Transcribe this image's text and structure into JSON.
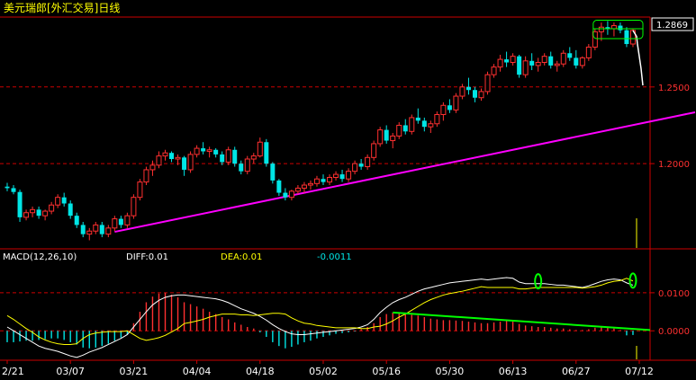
{
  "title": "美元瑞郎[外汇交易]日线",
  "last_price_badge": "1.2869",
  "macd_header": {
    "name": "MACD(12,26,10)",
    "diff": "DIFF:0.01",
    "dea": "DEA:0.01",
    "macd": "-0.0011"
  },
  "colors": {
    "background": "#000000",
    "frame": "#cc0000",
    "up_candle": "#ff3030",
    "down_candle": "#00e5e5",
    "trendline_price": "#ff00ff",
    "trendline_macd": "#00ff00",
    "diff_line": "#ffffff",
    "dea_line": "#ffff00",
    "label": "#ffff00",
    "axis_text": "#ff3030"
  },
  "chart_data": [
    {
      "type": "candlestick",
      "title": "美元瑞郎[外汇交易]日线",
      "y_ticks": [
        "1.2000",
        "1.2500"
      ],
      "y_tick_values": [
        1.2,
        1.25
      ],
      "ylim": [
        1.145,
        1.295
      ],
      "x_tick_labels": [
        "2/21",
        "03/07",
        "03/21",
        "04/04",
        "04/18",
        "05/02",
        "05/16",
        "05/30",
        "06/13",
        "06/27",
        "07/12"
      ],
      "x_tick_index": [
        0,
        10,
        20,
        30,
        40,
        50,
        60,
        70,
        80,
        90,
        100
      ],
      "last_price": 1.2869,
      "grid": true,
      "candles": [
        [
          1.185,
          1.1875,
          1.182,
          1.184
        ],
        [
          1.184,
          1.186,
          1.18,
          1.1815
        ],
        [
          1.1815,
          1.183,
          1.162,
          1.165
        ],
        [
          1.165,
          1.17,
          1.163,
          1.168
        ],
        [
          1.168,
          1.172,
          1.165,
          1.17
        ],
        [
          1.17,
          1.172,
          1.164,
          1.166
        ],
        [
          1.166,
          1.17,
          1.163,
          1.169
        ],
        [
          1.169,
          1.175,
          1.167,
          1.173
        ],
        [
          1.173,
          1.18,
          1.171,
          1.178
        ],
        [
          1.178,
          1.181,
          1.172,
          1.174
        ],
        [
          1.174,
          1.176,
          1.164,
          1.166
        ],
        [
          1.166,
          1.168,
          1.158,
          1.16
        ],
        [
          1.16,
          1.162,
          1.152,
          1.154
        ],
        [
          1.154,
          1.158,
          1.15,
          1.156
        ],
        [
          1.156,
          1.162,
          1.154,
          1.16
        ],
        [
          1.16,
          1.162,
          1.152,
          1.154
        ],
        [
          1.154,
          1.16,
          1.152,
          1.158
        ],
        [
          1.158,
          1.166,
          1.156,
          1.164
        ],
        [
          1.164,
          1.166,
          1.158,
          1.16
        ],
        [
          1.16,
          1.168,
          1.158,
          1.166
        ],
        [
          1.166,
          1.18,
          1.164,
          1.178
        ],
        [
          1.178,
          1.19,
          1.176,
          1.188
        ],
        [
          1.188,
          1.198,
          1.186,
          1.196
        ],
        [
          1.196,
          1.202,
          1.192,
          1.199
        ],
        [
          1.199,
          1.208,
          1.197,
          1.205
        ],
        [
          1.205,
          1.209,
          1.202,
          1.207
        ],
        [
          1.207,
          1.208,
          1.201,
          1.203
        ],
        [
          1.203,
          1.206,
          1.199,
          1.204
        ],
        [
          1.204,
          1.205,
          1.192,
          1.196
        ],
        [
          1.196,
          1.208,
          1.194,
          1.206
        ],
        [
          1.206,
          1.212,
          1.204,
          1.21
        ],
        [
          1.21,
          1.214,
          1.206,
          1.208
        ],
        [
          1.208,
          1.211,
          1.204,
          1.209
        ],
        [
          1.209,
          1.21,
          1.204,
          1.206
        ],
        [
          1.206,
          1.208,
          1.199,
          1.201
        ],
        [
          1.201,
          1.211,
          1.199,
          1.209
        ],
        [
          1.209,
          1.211,
          1.198,
          1.2
        ],
        [
          1.2,
          1.202,
          1.193,
          1.195
        ],
        [
          1.195,
          1.205,
          1.193,
          1.203
        ],
        [
          1.203,
          1.207,
          1.2,
          1.205
        ],
        [
          1.205,
          1.217,
          1.204,
          1.214
        ],
        [
          1.214,
          1.216,
          1.198,
          1.2
        ],
        [
          1.2,
          1.201,
          1.187,
          1.189
        ],
        [
          1.189,
          1.19,
          1.179,
          1.181
        ],
        [
          1.181,
          1.184,
          1.176,
          1.178
        ],
        [
          1.178,
          1.183,
          1.176,
          1.182
        ],
        [
          1.182,
          1.186,
          1.18,
          1.184
        ],
        [
          1.184,
          1.188,
          1.181,
          1.186
        ],
        [
          1.186,
          1.189,
          1.183,
          1.187
        ],
        [
          1.187,
          1.192,
          1.185,
          1.19
        ],
        [
          1.19,
          1.193,
          1.186,
          1.188
        ],
        [
          1.188,
          1.193,
          1.186,
          1.191
        ],
        [
          1.191,
          1.195,
          1.189,
          1.193
        ],
        [
          1.193,
          1.196,
          1.188,
          1.19
        ],
        [
          1.19,
          1.197,
          1.188,
          1.195
        ],
        [
          1.195,
          1.202,
          1.193,
          1.2
        ],
        [
          1.2,
          1.203,
          1.196,
          1.198
        ],
        [
          1.198,
          1.206,
          1.196,
          1.204
        ],
        [
          1.204,
          1.215,
          1.202,
          1.213
        ],
        [
          1.213,
          1.224,
          1.211,
          1.222
        ],
        [
          1.222,
          1.225,
          1.213,
          1.215
        ],
        [
          1.215,
          1.22,
          1.21,
          1.218
        ],
        [
          1.218,
          1.227,
          1.216,
          1.225
        ],
        [
          1.225,
          1.229,
          1.219,
          1.221
        ],
        [
          1.221,
          1.232,
          1.219,
          1.23
        ],
        [
          1.23,
          1.236,
          1.226,
          1.228
        ],
        [
          1.228,
          1.23,
          1.221,
          1.224
        ],
        [
          1.224,
          1.228,
          1.22,
          1.226
        ],
        [
          1.226,
          1.234,
          1.224,
          1.232
        ],
        [
          1.232,
          1.24,
          1.228,
          1.238
        ],
        [
          1.238,
          1.242,
          1.233,
          1.235
        ],
        [
          1.235,
          1.246,
          1.233,
          1.244
        ],
        [
          1.244,
          1.252,
          1.242,
          1.25
        ],
        [
          1.25,
          1.256,
          1.245,
          1.248
        ],
        [
          1.248,
          1.25,
          1.24,
          1.243
        ],
        [
          1.243,
          1.249,
          1.241,
          1.247
        ],
        [
          1.247,
          1.26,
          1.245,
          1.258
        ],
        [
          1.258,
          1.265,
          1.256,
          1.263
        ],
        [
          1.263,
          1.271,
          1.26,
          1.268
        ],
        [
          1.268,
          1.273,
          1.263,
          1.266
        ],
        [
          1.266,
          1.272,
          1.264,
          1.27
        ],
        [
          1.27,
          1.271,
          1.256,
          1.258
        ],
        [
          1.258,
          1.27,
          1.256,
          1.267
        ],
        [
          1.267,
          1.272,
          1.261,
          1.264
        ],
        [
          1.264,
          1.269,
          1.26,
          1.266
        ],
        [
          1.266,
          1.272,
          1.264,
          1.27
        ],
        [
          1.27,
          1.273,
          1.262,
          1.264
        ],
        [
          1.264,
          1.267,
          1.26,
          1.265
        ],
        [
          1.265,
          1.274,
          1.263,
          1.272
        ],
        [
          1.272,
          1.276,
          1.267,
          1.269
        ],
        [
          1.269,
          1.274,
          1.262,
          1.264
        ],
        [
          1.264,
          1.27,
          1.262,
          1.269
        ],
        [
          1.269,
          1.278,
          1.267,
          1.276
        ],
        [
          1.276,
          1.288,
          1.274,
          1.286
        ],
        [
          1.286,
          1.292,
          1.28,
          1.289
        ],
        [
          1.289,
          1.293,
          1.284,
          1.288
        ],
        [
          1.288,
          1.292,
          1.283,
          1.29
        ],
        [
          1.29,
          1.292,
          1.285,
          1.287
        ],
        [
          1.287,
          1.289,
          1.276,
          1.278
        ],
        [
          1.278,
          1.288,
          1.276,
          1.2869
        ]
      ]
    },
    {
      "type": "line",
      "title": "MACD(12,26,10)",
      "y_ticks": [
        "0.0100",
        "0.0000"
      ],
      "y_tick_values": [
        0.01,
        0.0
      ],
      "ylim": [
        -0.0075,
        0.018
      ],
      "macd_bars": [
        -0.003,
        -0.003,
        -0.0028,
        -0.0026,
        -0.0026,
        -0.0024,
        -0.0022,
        -0.002,
        -0.002,
        -0.0024,
        -0.003,
        -0.0036,
        -0.0044,
        -0.0046,
        -0.0044,
        -0.004,
        -0.0034,
        -0.0026,
        -0.0018,
        -0.001,
        0.002,
        0.005,
        0.0075,
        0.009,
        0.0098,
        0.01,
        0.0095,
        0.0088,
        0.0075,
        0.007,
        0.0064,
        0.0058,
        0.005,
        0.0044,
        0.0036,
        0.003,
        0.0022,
        0.0016,
        0.001,
        0.0006,
        -0.0004,
        -0.0016,
        -0.003,
        -0.004,
        -0.0046,
        -0.0042,
        -0.0036,
        -0.003,
        -0.0026,
        -0.002,
        -0.0016,
        -0.0012,
        -0.0008,
        -0.0006,
        -0.0004,
        -0.0002,
        0.0004,
        0.001,
        0.002,
        0.0036,
        0.0044,
        0.0048,
        0.0046,
        0.0044,
        0.0042,
        0.004,
        0.0036,
        0.0032,
        0.003,
        0.0028,
        0.0028,
        0.0027,
        0.0026,
        0.0024,
        0.0022,
        0.002,
        0.002,
        0.0022,
        0.0024,
        0.0026,
        0.0024,
        0.0018,
        0.0014,
        0.0012,
        0.001,
        0.001,
        0.0008,
        0.0006,
        0.0006,
        0.0004,
        0.0002,
        0.0002,
        0.0004,
        0.0008,
        0.001,
        0.0008,
        0.0006,
        0.0002,
        -0.0012,
        -0.0011
      ],
      "series": [
        {
          "name": "DIFF",
          "values": [
            0.001,
            0.0,
            -0.001,
            -0.002,
            -0.003,
            -0.004,
            -0.0046,
            -0.005,
            -0.0054,
            -0.006,
            -0.0066,
            -0.007,
            -0.0064,
            -0.0056,
            -0.005,
            -0.0044,
            -0.0036,
            -0.0028,
            -0.002,
            -0.001,
            0.001,
            0.003,
            0.005,
            0.0068,
            0.008,
            0.0088,
            0.0092,
            0.0094,
            0.0094,
            0.0092,
            0.009,
            0.0088,
            0.0086,
            0.0084,
            0.008,
            0.0074,
            0.0066,
            0.0058,
            0.0052,
            0.0046,
            0.0038,
            0.0028,
            0.0016,
            0.0006,
            -0.0002,
            -0.0008,
            -0.001,
            -0.001,
            -0.0008,
            -0.0006,
            -0.0004,
            -0.0002,
            0.0,
            0.0002,
            0.0004,
            0.0006,
            0.001,
            0.0016,
            0.003,
            0.0048,
            0.0062,
            0.0074,
            0.0082,
            0.0088,
            0.0096,
            0.0104,
            0.011,
            0.0114,
            0.0118,
            0.0122,
            0.0126,
            0.0128,
            0.013,
            0.0132,
            0.0134,
            0.0136,
            0.0134,
            0.0136,
            0.0138,
            0.014,
            0.0138,
            0.0128,
            0.0124,
            0.0124,
            0.0124,
            0.0124,
            0.0122,
            0.012,
            0.012,
            0.0118,
            0.0116,
            0.0114,
            0.0118,
            0.0124,
            0.013,
            0.0134,
            0.0136,
            0.0134,
            0.0126,
            0.012
          ]
        },
        {
          "name": "DEA",
          "values": [
            0.004,
            0.003,
            0.0018,
            0.0006,
            -0.0004,
            -0.0016,
            -0.0024,
            -0.003,
            -0.0034,
            -0.0036,
            -0.0036,
            -0.0034,
            -0.002,
            -0.001,
            -0.0006,
            -0.0004,
            -0.0002,
            -0.0002,
            -0.0002,
            0.0,
            -0.001,
            -0.002,
            -0.0025,
            -0.0022,
            -0.0018,
            -0.0012,
            -0.0003,
            0.0006,
            0.0019,
            0.0022,
            0.0026,
            0.003,
            0.0036,
            0.004,
            0.0044,
            0.0044,
            0.0044,
            0.0042,
            0.0042,
            0.004,
            0.0042,
            0.0044,
            0.0046,
            0.0046,
            0.0044,
            0.0034,
            0.0026,
            0.002,
            0.0018,
            0.0014,
            0.0012,
            0.001,
            0.0008,
            0.0008,
            0.0008,
            0.0008,
            0.0006,
            0.0006,
            0.001,
            0.0012,
            0.0018,
            0.0026,
            0.0036,
            0.0044,
            0.0054,
            0.0064,
            0.0074,
            0.0082,
            0.0088,
            0.0094,
            0.0098,
            0.0101,
            0.0104,
            0.0108,
            0.0112,
            0.0116,
            0.0114,
            0.0114,
            0.0114,
            0.0114,
            0.0114,
            0.011,
            0.011,
            0.0112,
            0.0114,
            0.0114,
            0.0114,
            0.0114,
            0.0114,
            0.0114,
            0.0114,
            0.0112,
            0.0114,
            0.0116,
            0.012,
            0.0126,
            0.013,
            0.0132,
            0.0138,
            0.0131
          ]
        }
      ]
    }
  ]
}
